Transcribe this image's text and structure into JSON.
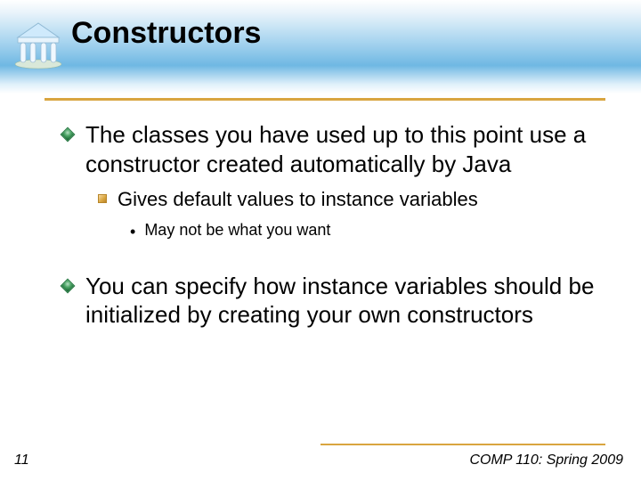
{
  "title": "Constructors",
  "bullets": [
    {
      "text": "The classes you have used up to this point use a constructor created automatically by Java",
      "sub": [
        {
          "text": "Gives default values to instance variables",
          "sub": [
            {
              "text": "May not be what you want"
            }
          ]
        }
      ]
    },
    {
      "text": "You can specify how instance variables should be initialized by creating your own constructors"
    }
  ],
  "footer": {
    "page": "11",
    "course": "COMP 110: Spring 2009"
  }
}
